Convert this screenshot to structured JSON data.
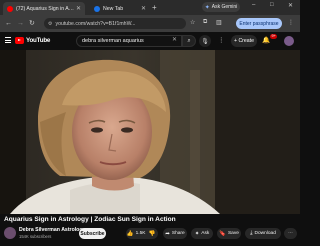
{
  "browser": {
    "tabs": [
      {
        "title": "(72) Aquarius Sign in Astro",
        "active": true
      },
      {
        "title": "New Tab",
        "active": false
      }
    ],
    "new_tab_symbol": "+",
    "ask_gemini": "Ask Gemini",
    "window_controls": {
      "minimize": "–",
      "maximize": "□",
      "close": "✕"
    },
    "address": "youtube.com/watch?v=B1f1mhW...",
    "passkey_button": "Enter passphrase"
  },
  "youtube": {
    "logo_text": "YouTube",
    "search_query": "debra silverman aquarius",
    "create_label": "+ Create",
    "notifications_count": "9+",
    "video": {
      "title": "Aquarius Sign in Astrology | Zodiac Sun Sign in Action",
      "channel": "Debra Silverman Astrology",
      "subscribers": "154K subscribers",
      "subscribe_label": "Subscribe",
      "like_count": "1.5K",
      "actions": {
        "share": "Share",
        "ask": "Ask",
        "save": "Save",
        "download": "Download",
        "more": "···"
      }
    }
  },
  "icons": {
    "back": "arrow-left-icon",
    "forward": "arrow-right-icon",
    "reload": "reload-icon",
    "site_info": "tune-icon",
    "bookmark": "star-icon",
    "extensions": "puzzle-icon",
    "search": "search-icon",
    "mic": "mic-icon",
    "bell": "bell-icon",
    "like": "thumbs-up-icon",
    "dislike": "thumbs-down-icon"
  },
  "colors": {
    "yt_red": "#ff0000",
    "background": "#0f0f0f",
    "passkey_blue": "#a8c7fa"
  }
}
